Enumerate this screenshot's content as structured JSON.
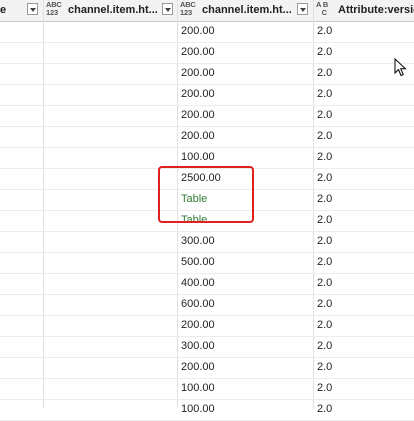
{
  "columns": [
    {
      "type_icon": "",
      "title": "e",
      "value_key": "c0"
    },
    {
      "type_icon": "ABC\n123",
      "title": "channel.item.ht...",
      "value_key": "c1"
    },
    {
      "type_icon": "ABC\n123",
      "title": "channel.item.ht...",
      "value_key": "c2"
    },
    {
      "type_icon": "A B\n   C",
      "title": "Attribute:versio",
      "value_key": "c3"
    }
  ],
  "rows": [
    {
      "c2": "200.00",
      "c3": "2.0"
    },
    {
      "c2": "200.00",
      "c3": "2.0"
    },
    {
      "c2": "200.00",
      "c3": "2.0"
    },
    {
      "c2": "200.00",
      "c3": "2.0"
    },
    {
      "c2": "200.00",
      "c3": "2.0"
    },
    {
      "c2": "200.00",
      "c3": "2.0"
    },
    {
      "c2": "100.00",
      "c3": "2.0"
    },
    {
      "c2": "2500.00",
      "c3": "2.0"
    },
    {
      "c2": "Table",
      "c3": "2.0"
    },
    {
      "c2": "Table",
      "c3": "2.0"
    },
    {
      "c2": "300.00",
      "c3": "2.0"
    },
    {
      "c2": "500.00",
      "c3": "2.0"
    },
    {
      "c2": "400.00",
      "c3": "2.0"
    },
    {
      "c2": "600.00",
      "c3": "2.0"
    },
    {
      "c2": "200.00",
      "c3": "2.0"
    },
    {
      "c2": "300.00",
      "c3": "2.0"
    },
    {
      "c2": "200.00",
      "c3": "2.0"
    },
    {
      "c2": "100.00",
      "c3": "2.0"
    },
    {
      "c2": "100.00",
      "c3": "2.0"
    }
  ],
  "colors": {
    "table_value": "#2e7d32",
    "highlight": "#e02020"
  }
}
